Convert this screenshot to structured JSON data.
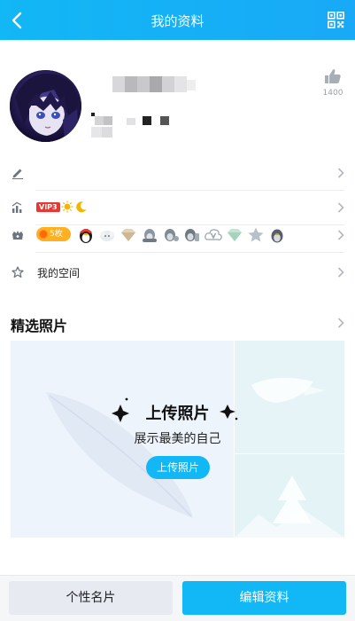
{
  "header": {
    "title": "我的资料",
    "back_icon": "chevron-left-icon",
    "qr_icon": "qr-code-icon",
    "bg_color": "#12b7f5"
  },
  "profile": {
    "like_count": "1400",
    "like_icon": "thumbs-up-icon"
  },
  "rows": {
    "signature": {
      "icon": "pencil-icon"
    },
    "level": {
      "icon": "level-chart-icon",
      "vip_label": "VIP3"
    },
    "badges": {
      "icon": "gift-icon",
      "coin_label": "5枚"
    },
    "space": {
      "icon": "star-icon",
      "label": "我的空间"
    }
  },
  "photos_section": {
    "title": "精选照片",
    "upload_title": "上传照片",
    "upload_subtitle": "展示最美的自己",
    "upload_button": "上传照片"
  },
  "footer": {
    "card_button": "个性名片",
    "edit_button": "编辑资料",
    "accent_color": "#12b7f5"
  }
}
